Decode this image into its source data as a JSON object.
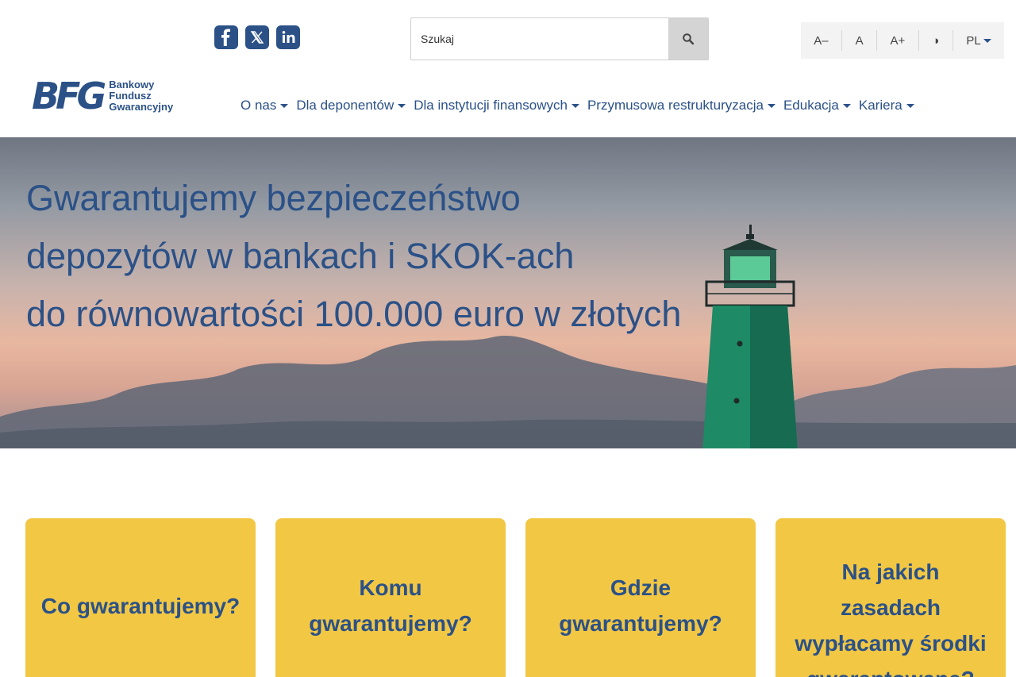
{
  "social": {
    "items": [
      {
        "name": "facebook",
        "glyph": "f"
      },
      {
        "name": "x",
        "glyph": "𝕏"
      },
      {
        "name": "linkedin",
        "glyph": "in"
      }
    ]
  },
  "search": {
    "placeholder": "Szukaj"
  },
  "accessibility": {
    "font_decrease": "A–",
    "font_normal": "A",
    "font_increase": "A+",
    "contrast": "◑",
    "language": "PL"
  },
  "logo": {
    "mark": "BFG",
    "line1": "Bankowy",
    "line2": "Fundusz",
    "line3": "Gwarancyjny"
  },
  "nav": {
    "items": [
      {
        "label": "O nas"
      },
      {
        "label": "Dla deponentów"
      },
      {
        "label": "Dla instytucji finansowych"
      },
      {
        "label": "Przymusowa restrukturyzacja"
      },
      {
        "label": "Edukacja"
      },
      {
        "label": "Kariera"
      }
    ]
  },
  "hero": {
    "line1": "Gwarantujemy bezpieczeństwo",
    "line2": "depozytów w bankach i SKOK-ach",
    "line3": "do równowartości 100.000 euro w złotych"
  },
  "cards": [
    {
      "label": "Co gwarantujemy?"
    },
    {
      "label": "Komu gwarantujemy?"
    },
    {
      "label": "Gdzie gwarantujemy?"
    },
    {
      "label": "Na jakich zasadach wypłacamy środki gwarantowane?"
    }
  ],
  "colors": {
    "brand_blue": "#2b5187",
    "card_yellow": "#f2c744"
  }
}
